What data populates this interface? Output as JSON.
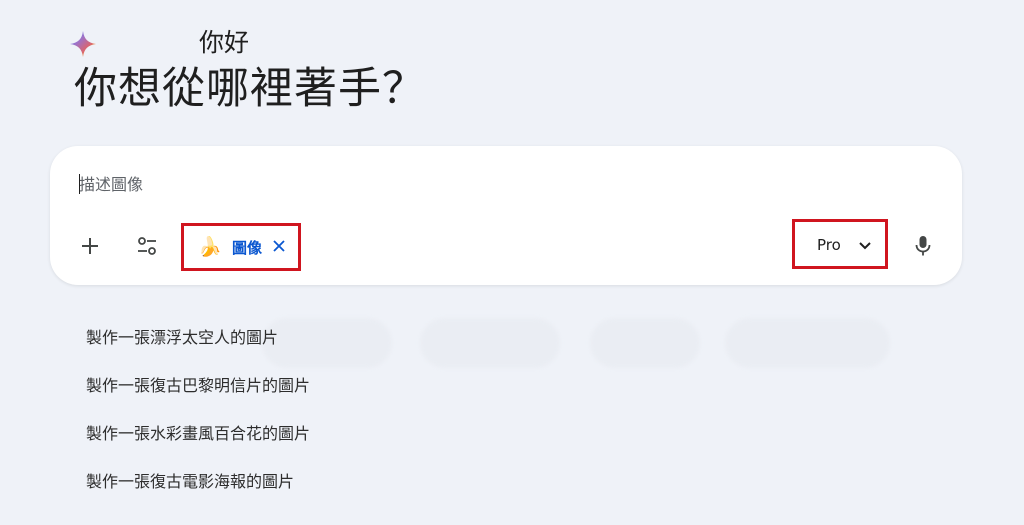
{
  "greeting": {
    "hello": "你好",
    "question": "你想從哪裡著手？"
  },
  "prompt": {
    "placeholder": "描述圖像",
    "add_icon": "plus-icon",
    "tools_icon": "tune-icon",
    "mic_icon": "mic-icon"
  },
  "tool_chip": {
    "icon": "banana",
    "emoji": "🍌",
    "label": "圖像",
    "close_icon": "close-icon"
  },
  "model": {
    "label": "Pro",
    "icon": "chevron-down-icon"
  },
  "suggestions": [
    "製作一張漂浮太空人的圖片",
    "製作一張復古巴黎明信片的圖片",
    "製作一張水彩畫風百合花的圖片",
    "製作一張復古電影海報的圖片"
  ],
  "colors": {
    "background": "#eff2f8",
    "card": "#ffffff",
    "accent_blue": "#0b57d0",
    "highlight_red": "#d0151f"
  }
}
